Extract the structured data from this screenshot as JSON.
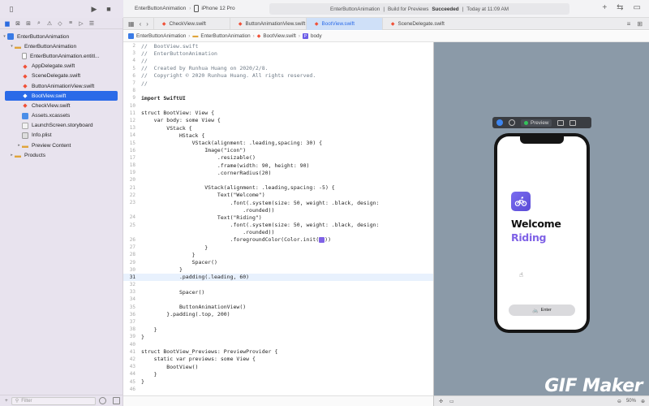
{
  "toolbar": {
    "scheme_project": "EnterButtonAnimation",
    "scheme_device": "iPhone 12 Pro",
    "activity_project": "EnterButtonAnimation",
    "activity_status_prefix": "Build for Previews",
    "activity_status": "Succeeded",
    "activity_time": "Today at 11:09 AM"
  },
  "navigator": {
    "items": [
      {
        "label": "EnterButtonAnimation",
        "kind": "project",
        "indent": 0,
        "disclosure": "▾"
      },
      {
        "label": "EnterButtonAnimation",
        "kind": "folder",
        "indent": 1,
        "disclosure": "▾"
      },
      {
        "label": "EnterButtonAnimation.entitl...",
        "kind": "file",
        "indent": 2,
        "disclosure": ""
      },
      {
        "label": "AppDelegate.swift",
        "kind": "swift",
        "indent": 2,
        "disclosure": ""
      },
      {
        "label": "SceneDelegate.swift",
        "kind": "swift",
        "indent": 2,
        "disclosure": ""
      },
      {
        "label": "ButtonAnimationView.swift",
        "kind": "swift",
        "indent": 2,
        "disclosure": ""
      },
      {
        "label": "BootView.swift",
        "kind": "swift",
        "indent": 2,
        "disclosure": "",
        "selected": true
      },
      {
        "label": "CheckView.swift",
        "kind": "swift",
        "indent": 2,
        "disclosure": ""
      },
      {
        "label": "Assets.xcassets",
        "kind": "assets",
        "indent": 2,
        "disclosure": ""
      },
      {
        "label": "LaunchScreen.storyboard",
        "kind": "storyboard",
        "indent": 2,
        "disclosure": ""
      },
      {
        "label": "Info.plist",
        "kind": "plist",
        "indent": 2,
        "disclosure": ""
      },
      {
        "label": "Preview Content",
        "kind": "folder",
        "indent": 2,
        "disclosure": "▸"
      },
      {
        "label": "Products",
        "kind": "folder",
        "indent": 1,
        "disclosure": "▸"
      }
    ],
    "filter_placeholder": "Filter"
  },
  "tabs": [
    {
      "label": "CheckView.swift",
      "active": false
    },
    {
      "label": "ButtonAnimationView.swift",
      "active": false
    },
    {
      "label": "BootView.swift",
      "active": true
    },
    {
      "label": "SceneDelegate.swift",
      "active": false
    }
  ],
  "jumpbar": {
    "project": "EnterButtonAnimation",
    "folder": "EnterButtonAnimation",
    "file": "BootView.swift",
    "symbol": "body"
  },
  "code": [
    {
      "n": "2",
      "t": "//  BootView.swift",
      "c": true
    },
    {
      "n": "3",
      "t": "//  EnterButtonAnimation",
      "c": true
    },
    {
      "n": "4",
      "t": "//",
      "c": true
    },
    {
      "n": "5",
      "t": "//  Created by Runhua Huang on 2020/2/8.",
      "c": true
    },
    {
      "n": "6",
      "t": "//  Copyright © 2020 Runhua Huang. All rights reserved.",
      "c": true
    },
    {
      "n": "7",
      "t": "//",
      "c": true
    },
    {
      "n": "8",
      "t": ""
    },
    {
      "n": "9",
      "t": "import SwiftUI",
      "imp": true
    },
    {
      "n": "10",
      "t": ""
    },
    {
      "n": "11",
      "t": "struct BootView: View {"
    },
    {
      "n": "12",
      "t": "    var body: some View {"
    },
    {
      "n": "13",
      "t": "        VStack {"
    },
    {
      "n": "14",
      "t": "            HStack {"
    },
    {
      "n": "15",
      "t": "                VStack(alignment: .leading,spacing: 30) {"
    },
    {
      "n": "16",
      "t": "                    Image(\"icon\")"
    },
    {
      "n": "17",
      "t": "                        .resizable()"
    },
    {
      "n": "18",
      "t": "                        .frame(width: 90, height: 90)"
    },
    {
      "n": "19",
      "t": "                        .cornerRadius(20)"
    },
    {
      "n": "20",
      "t": ""
    },
    {
      "n": "21",
      "t": "                    VStack(alignment: .leading,spacing: -5) {"
    },
    {
      "n": "22",
      "t": "                        Text(\"Welcome\")"
    },
    {
      "n": "23",
      "t": "                            .font(.system(size: 50, weight: .black, design:"
    },
    {
      "n": "",
      "t": "                                .rounded))"
    },
    {
      "n": "24",
      "t": "                        Text(\"Riding\")"
    },
    {
      "n": "25",
      "t": "                            .font(.system(size: 50, weight: .black, design:"
    },
    {
      "n": "",
      "t": "                                .rounded))"
    },
    {
      "n": "26",
      "t": "                            .foregroundColor(Color.init(■))"
    },
    {
      "n": "27",
      "t": "                    }"
    },
    {
      "n": "28",
      "t": "                }"
    },
    {
      "n": "29",
      "t": "                Spacer()"
    },
    {
      "n": "30",
      "t": "            }"
    },
    {
      "n": "31",
      "t": "            .padding(.leading, 60)",
      "current": true
    },
    {
      "n": "32",
      "t": ""
    },
    {
      "n": "33",
      "t": "            Spacer()"
    },
    {
      "n": "34",
      "t": ""
    },
    {
      "n": "35",
      "t": "            ButtonAnimationView()"
    },
    {
      "n": "36",
      "t": "        }.padding(.top, 200)"
    },
    {
      "n": "37",
      "t": ""
    },
    {
      "n": "38",
      "t": "    }"
    },
    {
      "n": "39",
      "t": "}"
    },
    {
      "n": "40",
      "t": ""
    },
    {
      "n": "41",
      "t": "struct BootView_Previews: PreviewProvider {"
    },
    {
      "n": "42",
      "t": "    static var previews: some View {"
    },
    {
      "n": "43",
      "t": "        BootView()"
    },
    {
      "n": "44",
      "t": "    }"
    },
    {
      "n": "45",
      "t": "}"
    },
    {
      "n": "46",
      "t": ""
    }
  ],
  "preview": {
    "bar_label": "Preview",
    "welcome": "Welcome",
    "riding": "Riding",
    "enter_label": "Enter",
    "zoom": "50%",
    "accent_color": "#7f62e6",
    "icon_name": "bicycle-icon"
  },
  "watermark": "GIF Maker"
}
